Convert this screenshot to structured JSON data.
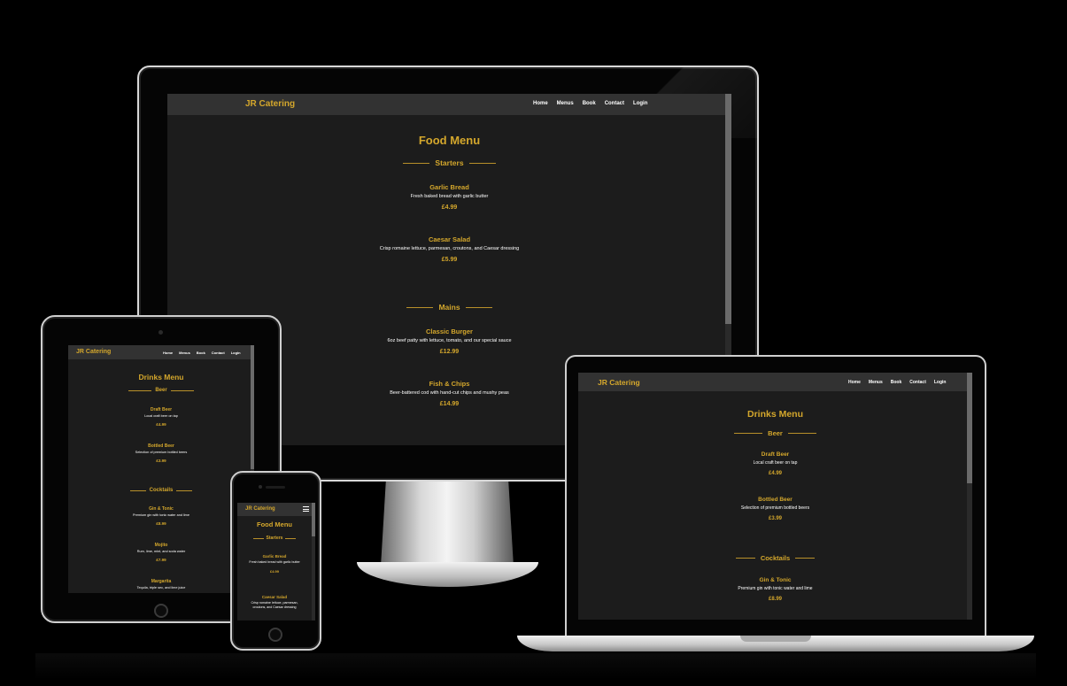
{
  "desktop": {
    "brand": "JR Catering",
    "nav": [
      "Home",
      "Menus",
      "Book",
      "Contact",
      "Login"
    ],
    "title": "Food Menu",
    "sections": [
      {
        "heading": "Starters",
        "items": [
          {
            "name": "Garlic Bread",
            "desc": "Fresh baked bread with garlic butter",
            "price": "£4.99"
          },
          {
            "name": "Caesar Salad",
            "desc": "Crisp romaine lettuce, parmesan, croutons, and Caesar dressing",
            "price": "£5.99"
          }
        ]
      },
      {
        "heading": "Mains",
        "items": [
          {
            "name": "Classic Burger",
            "desc": "6oz beef patty with lettuce, tomato, and our special sauce",
            "price": "£12.99"
          },
          {
            "name": "Fish & Chips",
            "desc": "Beer-battered cod with hand-cut chips and mushy peas",
            "price": "£14.99"
          }
        ]
      }
    ]
  },
  "tablet": {
    "brand": "JR Catering",
    "nav": [
      "Home",
      "Menus",
      "Book",
      "Contact",
      "Login"
    ],
    "title": "Drinks Menu",
    "sections": [
      {
        "heading": "Beer",
        "items": [
          {
            "name": "Draft Beer",
            "desc": "Local craft beer on tap",
            "price": "£4.99"
          },
          {
            "name": "Bottled Beer",
            "desc": "Selection of premium bottled beers",
            "price": "£3.99"
          }
        ]
      },
      {
        "heading": "Cocktails",
        "items": [
          {
            "name": "Gin & Tonic",
            "desc": "Premium gin with tonic water and lime",
            "price": "£8.99"
          },
          {
            "name": "Mojito",
            "desc": "Rum, lime, mint, and soda water",
            "price": "£7.99"
          },
          {
            "name": "Margarita",
            "desc": "Tequila, triple sec, and lime juice",
            "price": ""
          }
        ]
      }
    ]
  },
  "laptop": {
    "brand": "JR Catering",
    "nav": [
      "Home",
      "Menus",
      "Book",
      "Contact",
      "Login"
    ],
    "title": "Drinks Menu",
    "sections": [
      {
        "heading": "Beer",
        "items": [
          {
            "name": "Draft Beer",
            "desc": "Local craft beer on tap",
            "price": "£4.99"
          },
          {
            "name": "Bottled Beer",
            "desc": "Selection of premium bottled beers",
            "price": "£3.99"
          }
        ]
      },
      {
        "heading": "Cocktails",
        "items": [
          {
            "name": "Gin & Tonic",
            "desc": "Premium gin with tonic water and lime",
            "price": "£8.99"
          }
        ]
      }
    ]
  },
  "phone": {
    "brand": "JR Catering",
    "menu_icon": "hamburger-icon",
    "title": "Food Menu",
    "sections": [
      {
        "heading": "Starters",
        "items": [
          {
            "name": "Garlic Bread",
            "desc": "Fresh baked bread with garlic butter",
            "price": "£4.99"
          },
          {
            "name": "Caesar Salad",
            "desc": "Crisp romaine lettuce, parmesan, croutons, and Caesar dressing",
            "price": ""
          }
        ]
      }
    ]
  },
  "colors": {
    "accent": "#d4a72c",
    "background": "#1c1c1c",
    "navbar": "#323232",
    "text": "#ffffff"
  }
}
